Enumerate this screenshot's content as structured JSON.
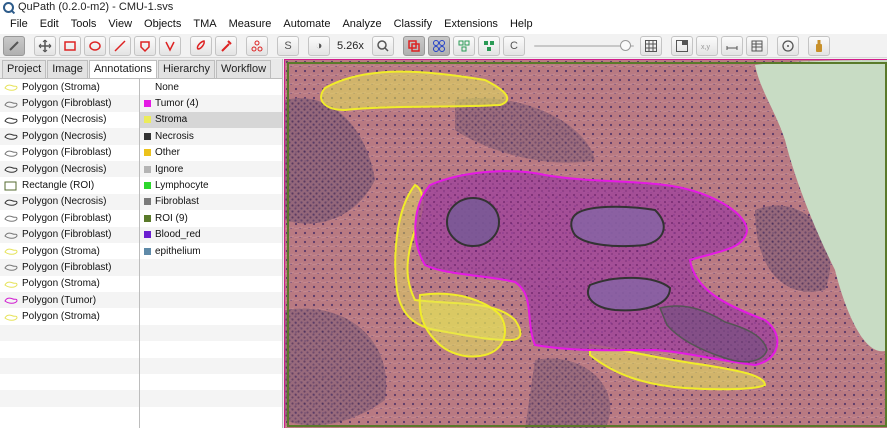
{
  "window": {
    "title": "QuPath (0.2.0-m2) - CMU-1.svs"
  },
  "menu": [
    "File",
    "Edit",
    "Tools",
    "View",
    "Objects",
    "TMA",
    "Measure",
    "Automate",
    "Analyze",
    "Classify",
    "Extensions",
    "Help"
  ],
  "toolbar": {
    "zoom": "5.26x",
    "brightness_symbol": "◑",
    "s_label": "S",
    "c_label": "C"
  },
  "tabs": [
    "Project",
    "Image",
    "Annotations",
    "Hierarchy",
    "Workflow"
  ],
  "active_tab": "Annotations",
  "annotations": [
    {
      "label": "Polygon (Stroma)",
      "icon": "polygon-stroma-icon",
      "color": "#e6e35a"
    },
    {
      "label": "Polygon (Fibroblast)",
      "icon": "polygon-fibroblast-icon",
      "color": "#777777"
    },
    {
      "label": "Polygon (Necrosis)",
      "icon": "polygon-necrosis-icon",
      "color": "#333333"
    },
    {
      "label": "Polygon (Necrosis)",
      "icon": "polygon-necrosis-icon",
      "color": "#333333"
    },
    {
      "label": "Polygon (Fibroblast)",
      "icon": "polygon-fibroblast-icon",
      "color": "#777777"
    },
    {
      "label": "Polygon (Necrosis)",
      "icon": "polygon-necrosis-icon",
      "color": "#333333"
    },
    {
      "label": "Rectangle (ROI)",
      "icon": "rectangle-roi-icon",
      "color": "#556b2f"
    },
    {
      "label": "Polygon (Necrosis)",
      "icon": "polygon-necrosis-icon",
      "color": "#333333"
    },
    {
      "label": "Polygon (Fibroblast)",
      "icon": "polygon-fibroblast-icon",
      "color": "#777777"
    },
    {
      "label": "Polygon (Fibroblast)",
      "icon": "polygon-fibroblast-icon",
      "color": "#777777"
    },
    {
      "label": "Polygon (Stroma)",
      "icon": "polygon-stroma-icon",
      "color": "#e6e35a"
    },
    {
      "label": "Polygon (Fibroblast)",
      "icon": "polygon-fibroblast-icon",
      "color": "#777777"
    },
    {
      "label": "Polygon (Stroma)",
      "icon": "polygon-stroma-icon",
      "color": "#e6e35a"
    },
    {
      "label": "Polygon (Tumor)",
      "icon": "polygon-tumor-icon",
      "color": "#d01bd0"
    },
    {
      "label": "Polygon (Stroma)",
      "icon": "polygon-stroma-icon",
      "color": "#e6e35a"
    }
  ],
  "classes": [
    {
      "label": "None",
      "color": ""
    },
    {
      "label": "Tumor (4)",
      "color": "#e41ae4"
    },
    {
      "label": "Stroma",
      "color": "#ecec5a"
    },
    {
      "label": "Necrosis",
      "color": "#333333"
    },
    {
      "label": "Other",
      "color": "#ecc21c"
    },
    {
      "label": "Ignore",
      "color": "#b4b4b4"
    },
    {
      "label": "Lymphocyte",
      "color": "#2cd62c"
    },
    {
      "label": "Fibroblast",
      "color": "#7a7a7a"
    },
    {
      "label": "ROI (9)",
      "color": "#5a7a2a"
    },
    {
      "label": "Blood_red",
      "color": "#6b1fd1"
    },
    {
      "label": "epithelium",
      "color": "#5f8aa8"
    }
  ],
  "selected_class_index": 2
}
